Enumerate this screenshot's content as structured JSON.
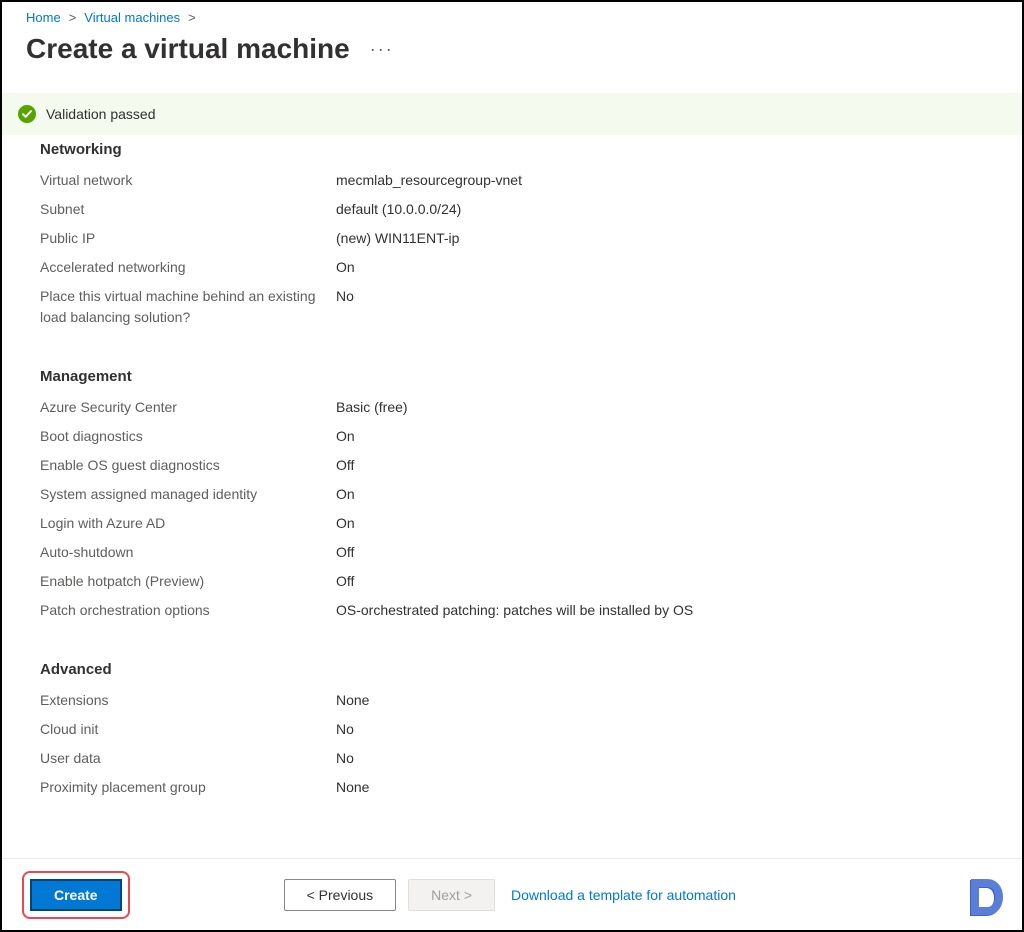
{
  "breadcrumb": {
    "home": "Home",
    "vms": "Virtual machines"
  },
  "title": "Create a virtual machine",
  "validation": {
    "text": "Validation passed"
  },
  "sections": {
    "networking": {
      "title": "Networking",
      "rows": [
        {
          "label": "Virtual network",
          "value": "mecmlab_resourcegroup-vnet"
        },
        {
          "label": "Subnet",
          "value": "default (10.0.0.0/24)"
        },
        {
          "label": "Public IP",
          "value": "(new) WIN11ENT-ip"
        },
        {
          "label": "Accelerated networking",
          "value": "On"
        },
        {
          "label": "Place this virtual machine behind an existing load balancing solution?",
          "value": "No"
        }
      ]
    },
    "management": {
      "title": "Management",
      "rows": [
        {
          "label": "Azure Security Center",
          "value": "Basic (free)"
        },
        {
          "label": "Boot diagnostics",
          "value": "On"
        },
        {
          "label": "Enable OS guest diagnostics",
          "value": "Off"
        },
        {
          "label": "System assigned managed identity",
          "value": "On"
        },
        {
          "label": "Login with Azure AD",
          "value": "On"
        },
        {
          "label": "Auto-shutdown",
          "value": "Off"
        },
        {
          "label": "Enable hotpatch (Preview)",
          "value": "Off"
        },
        {
          "label": "Patch orchestration options",
          "value": "OS-orchestrated patching: patches will be installed by OS"
        }
      ]
    },
    "advanced": {
      "title": "Advanced",
      "rows": [
        {
          "label": "Extensions",
          "value": "None"
        },
        {
          "label": "Cloud init",
          "value": "No"
        },
        {
          "label": "User data",
          "value": "No"
        },
        {
          "label": "Proximity placement group",
          "value": "None"
        }
      ]
    }
  },
  "footer": {
    "create": "Create",
    "previous": "<  Previous",
    "next": "Next  >",
    "download": "Download a template for automation"
  }
}
